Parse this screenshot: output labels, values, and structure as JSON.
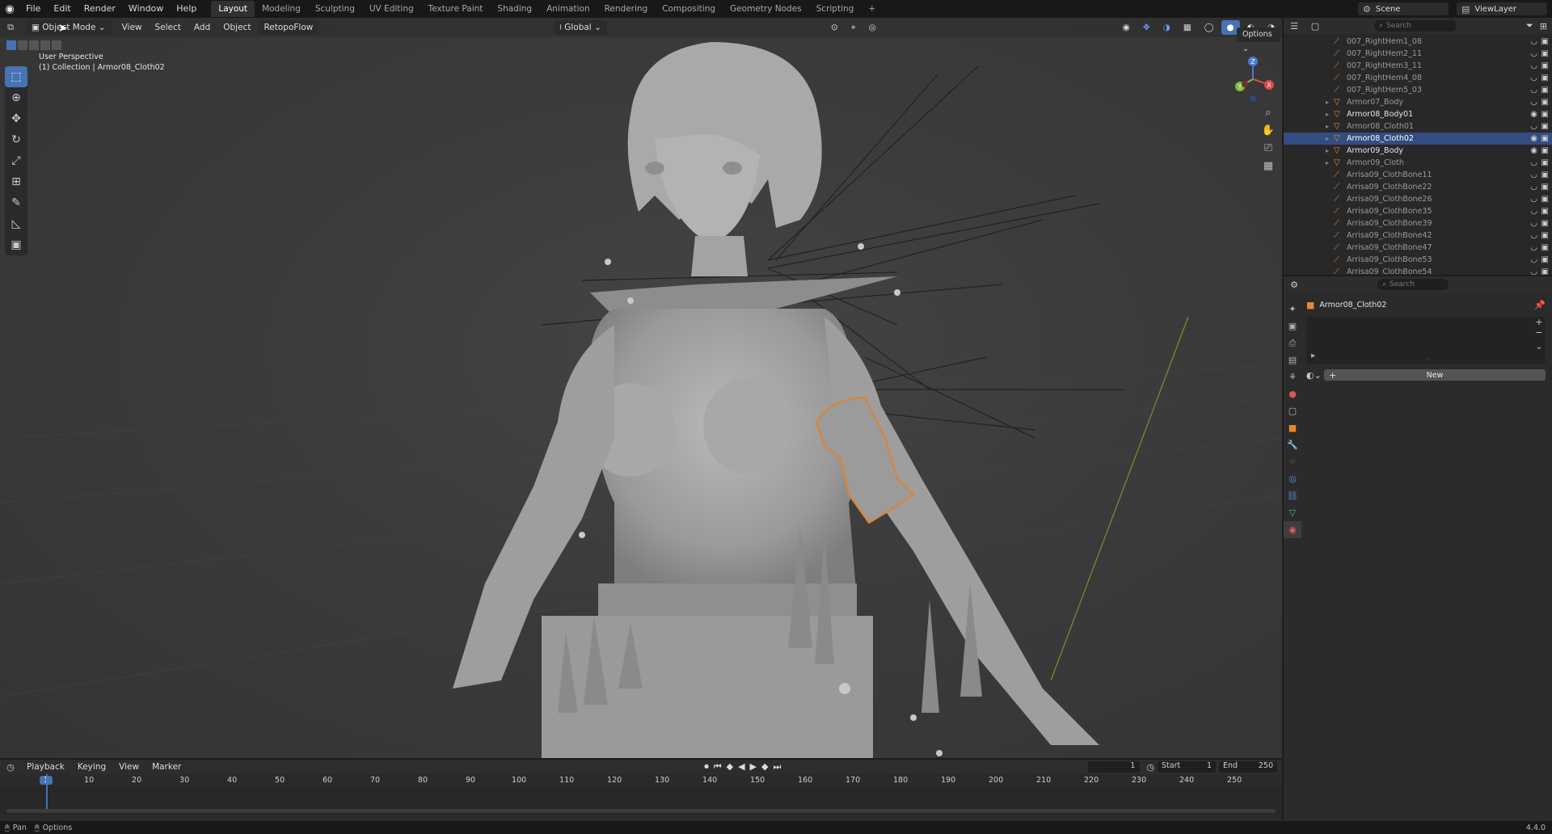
{
  "topbar": {
    "menus": [
      "File",
      "Edit",
      "Render",
      "Window",
      "Help"
    ],
    "workspaces": [
      "Layout",
      "Modeling",
      "Sculpting",
      "UV Editing",
      "Texture Paint",
      "Shading",
      "Animation",
      "Rendering",
      "Compositing",
      "Geometry Nodes",
      "Scripting"
    ],
    "add_tab": "+",
    "scene": "Scene",
    "view_layer": "ViewLayer"
  },
  "viewport": {
    "mode": "Object Mode",
    "menus": [
      "View",
      "Select",
      "Add",
      "Object",
      "RetopoFlow"
    ],
    "orientation": "Global",
    "options": "Options",
    "info_line1": "User Perspective",
    "info_line2": "(1) Collection | Armor08_Cloth02",
    "gizmo_x": "X",
    "gizmo_y": "Y",
    "gizmo_z": "Z"
  },
  "outliner": {
    "search_placeholder": "Search",
    "rows": [
      {
        "name": "007_RightHem1_08",
        "state": "dim"
      },
      {
        "name": "007_RightHem2_11",
        "state": "dim"
      },
      {
        "name": "007_RightHem3_11",
        "state": "dim"
      },
      {
        "name": "007_RightHem4_08",
        "state": "dim"
      },
      {
        "name": "007_RightHem5_03",
        "state": "dim"
      },
      {
        "name": "Armor07_Body",
        "state": "dim"
      },
      {
        "name": "Armor08_Body01",
        "state": "bright"
      },
      {
        "name": "Armor08_Cloth01",
        "state": "dim"
      },
      {
        "name": "Armor08_Cloth02",
        "state": "selected"
      },
      {
        "name": "Armor09_Body",
        "state": "bright"
      },
      {
        "name": "Armor09_Cloth",
        "state": "dim"
      },
      {
        "name": "Arrisa09_ClothBone11",
        "state": "dim"
      },
      {
        "name": "Arrisa09_ClothBone22",
        "state": "dim"
      },
      {
        "name": "Arrisa09_ClothBone26",
        "state": "dim"
      },
      {
        "name": "Arrisa09_ClothBone35",
        "state": "dim"
      },
      {
        "name": "Arrisa09_ClothBone39",
        "state": "dim"
      },
      {
        "name": "Arrisa09_ClothBone42",
        "state": "dim"
      },
      {
        "name": "Arrisa09_ClothBone47",
        "state": "dim"
      },
      {
        "name": "Arrisa09_ClothBone53",
        "state": "dim"
      },
      {
        "name": "Arrisa09_ClothBone54",
        "state": "dim"
      }
    ]
  },
  "properties": {
    "search_placeholder": "Search",
    "object_name": "Armor08_Cloth02",
    "new_button": "New"
  },
  "timeline": {
    "menus": [
      "Playback",
      "Keying",
      "View",
      "Marker"
    ],
    "current_frame": "1",
    "start_label": "Start",
    "start_value": "1",
    "end_label": "End",
    "end_value": "250",
    "ruler": [
      "1",
      "10",
      "20",
      "30",
      "40",
      "50",
      "60",
      "70",
      "80",
      "90",
      "100",
      "110",
      "120",
      "130",
      "140",
      "150",
      "160",
      "170",
      "180",
      "190",
      "200",
      "210",
      "220",
      "230",
      "240",
      "250"
    ]
  },
  "statusbar": {
    "left1": "Pan",
    "left2": "Options",
    "version": "4.4.0"
  }
}
